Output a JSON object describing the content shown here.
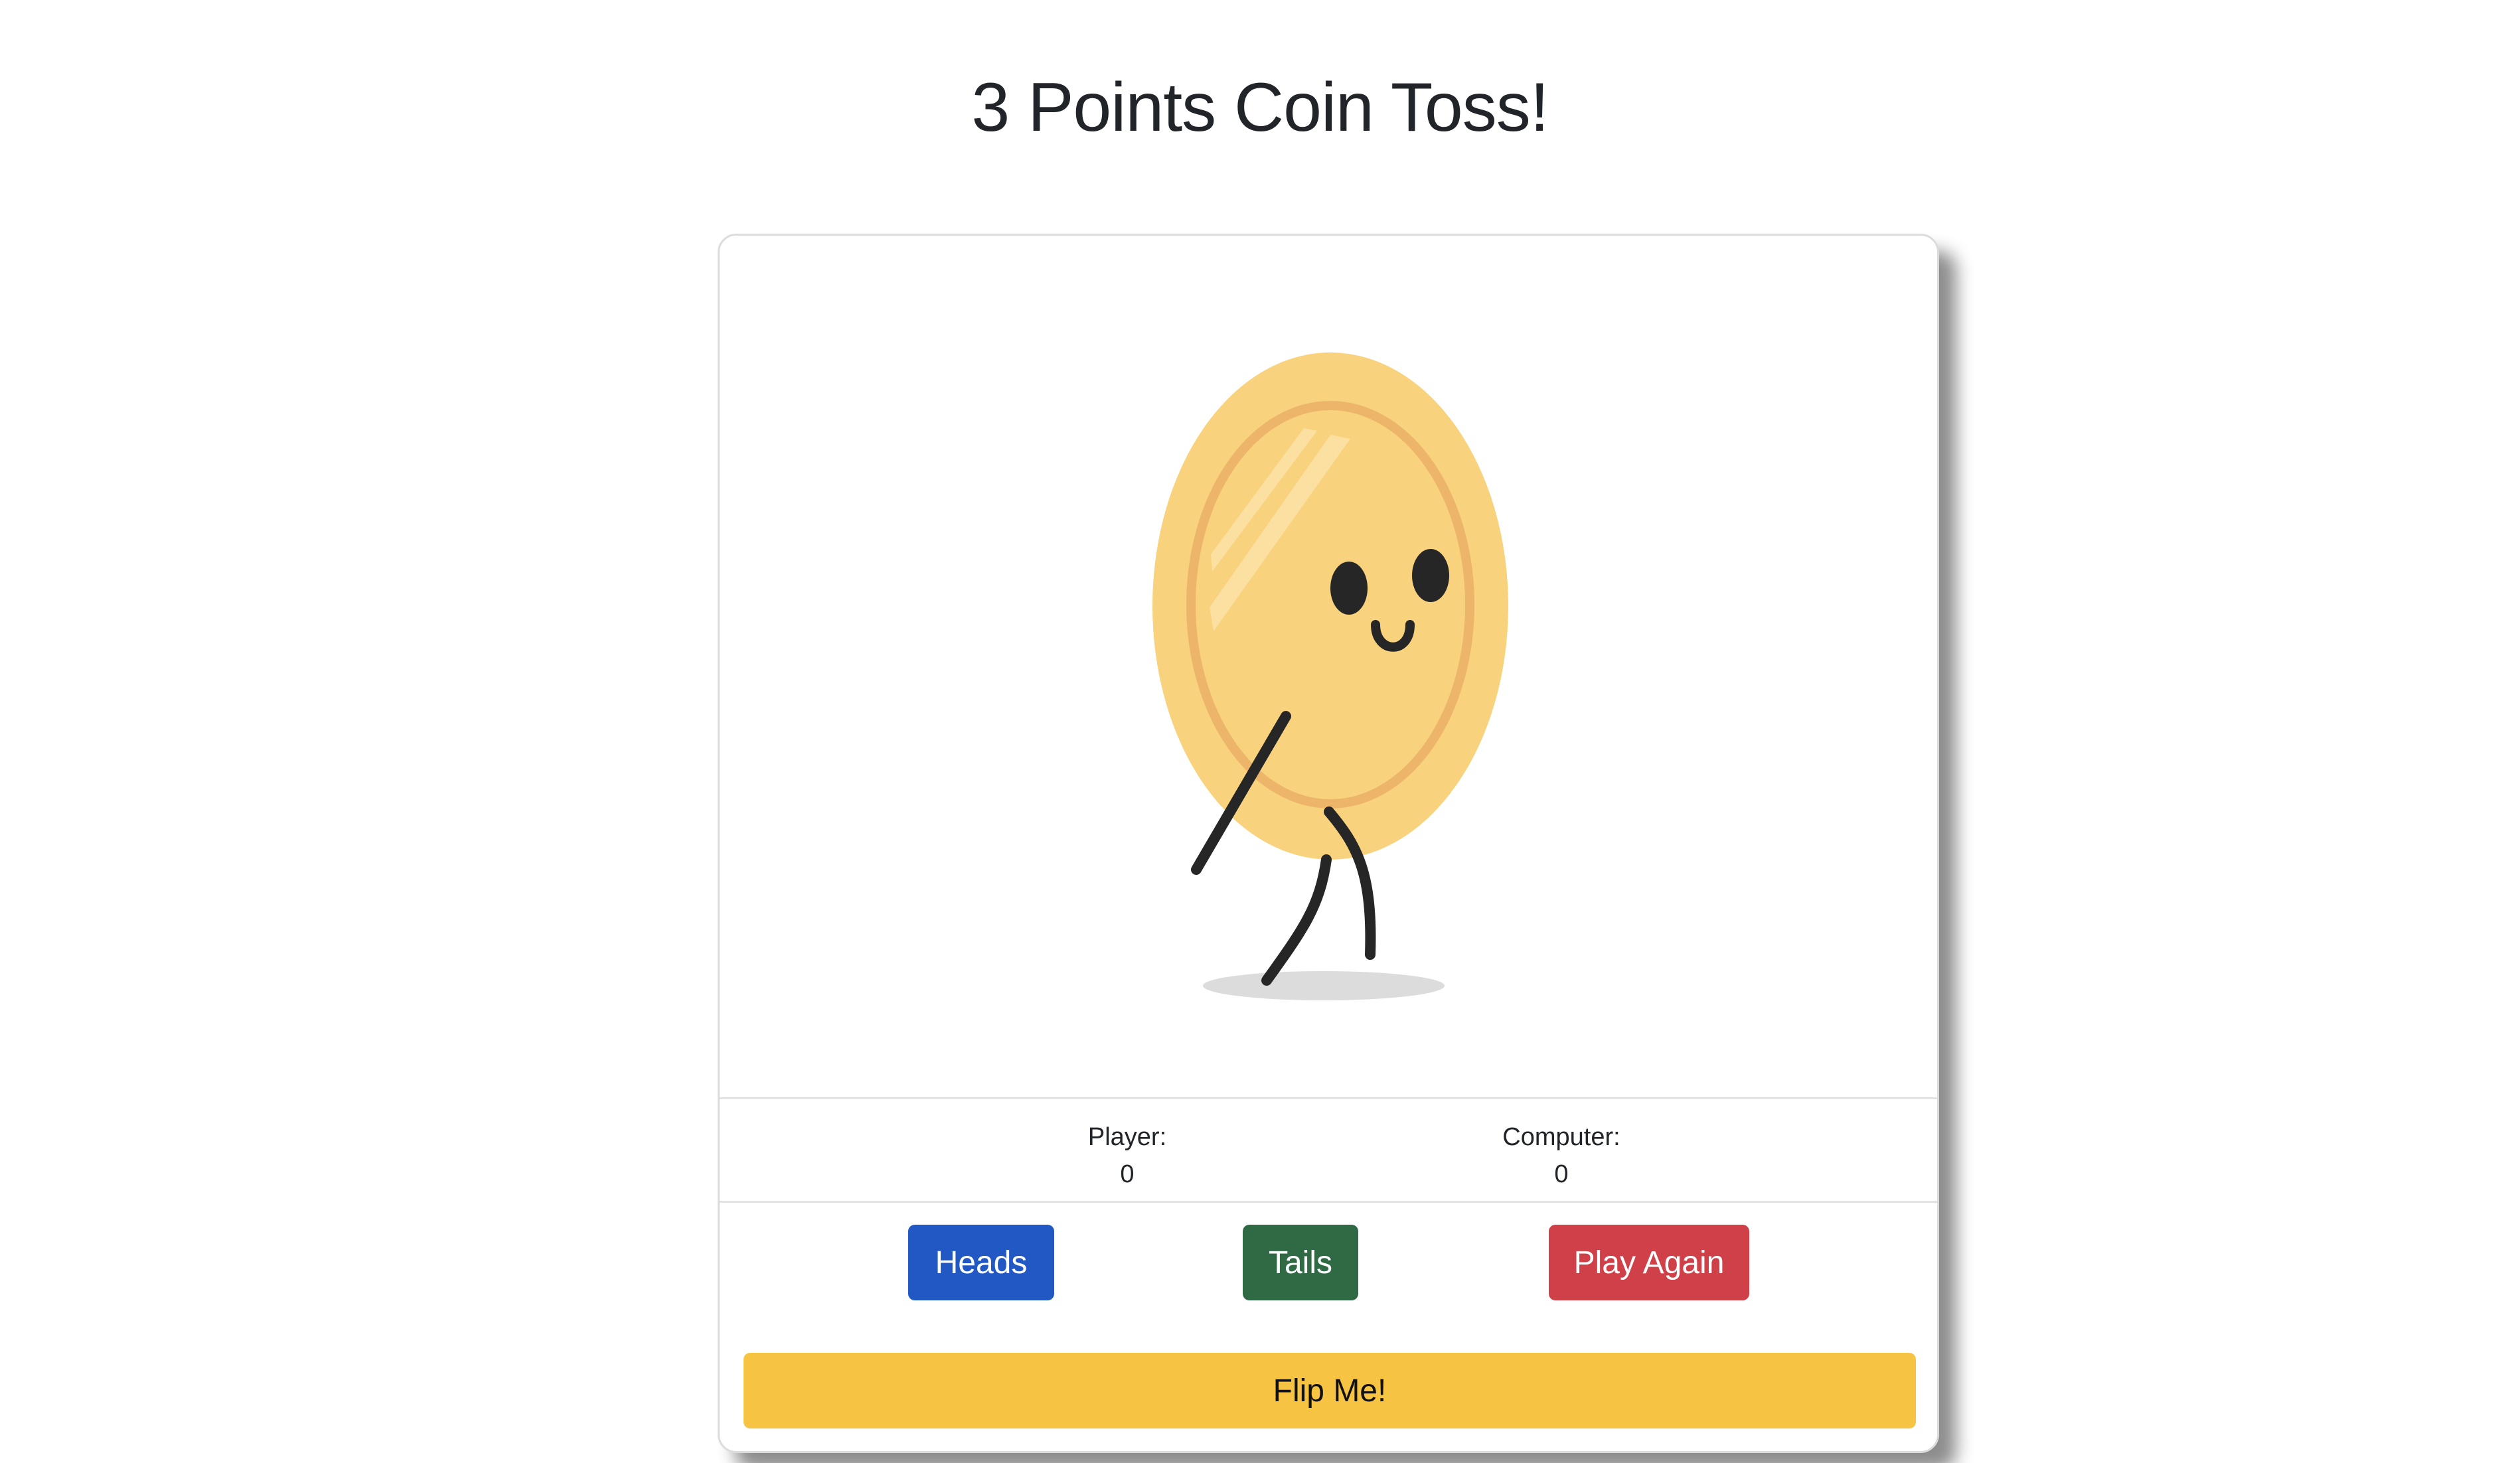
{
  "page": {
    "title": "3 Points Coin Toss!"
  },
  "scoreboard": {
    "player_label": "Player:",
    "player_score": "0",
    "computer_label": "Computer:",
    "computer_score": "0"
  },
  "buttons": {
    "heads": "Heads",
    "tails": "Tails",
    "play_again": "Play Again",
    "flip": "Flip Me!"
  },
  "colors": {
    "heads_button": "#2258c4",
    "tails_button": "#2f6a45",
    "play_again_button": "#cf4048",
    "flip_button": "#f7c343",
    "coin_face": "#f8d27d",
    "coin_rim": "#ecb56a"
  },
  "icons": {
    "coin": "walking-coin-illustration"
  }
}
